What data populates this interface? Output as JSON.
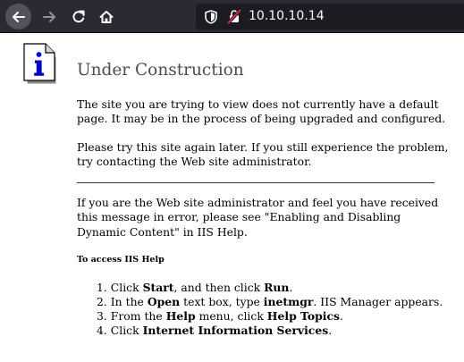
{
  "browser": {
    "url": "10.10.10.14",
    "colors": {
      "toolbar": "#2b2a33",
      "urlbar": "#1c1b22",
      "insecure_slash": "#e22850"
    },
    "icons": {
      "back": "arrow-left-icon",
      "forward": "arrow-right-icon",
      "reload": "reload-icon",
      "home": "home-icon",
      "tracking": "shield-icon",
      "insecure": "insecure-lock-icon"
    }
  },
  "page": {
    "icon": "info-icon",
    "title": "Under Construction",
    "para1": "The site you are trying to view does not currently have a default page. It may be in the process of being upgraded and configured.",
    "para2": "Please try this site again later. If you still experience the problem, try contacting the Web site administrator.",
    "para3": "If you are the Web site administrator and feel you have received this message in error, please see \"Enabling and Disabling Dynamic Content\" in IIS Help.",
    "help_heading": "To access IIS Help",
    "steps": [
      {
        "num": "1.",
        "t1": "Click ",
        "b1": "Start",
        "t2": ", and then click ",
        "b2": "Run",
        "t3": "."
      },
      {
        "num": "2.",
        "t1": "In the ",
        "b1": "Open",
        "t2": " text box, type ",
        "b2": "inetmgr",
        "t3": ". IIS Manager appears."
      },
      {
        "num": "3.",
        "t1": "From the ",
        "b1": "Help",
        "t2": " menu, click ",
        "b2": "Help Topics",
        "t3": "."
      },
      {
        "num": "4.",
        "t1": "Click ",
        "b1": "Internet Information Services",
        "t2": ".",
        "b2": "",
        "t3": ""
      }
    ]
  }
}
